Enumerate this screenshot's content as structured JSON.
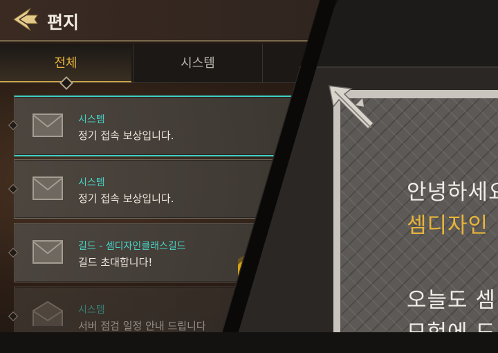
{
  "header": {
    "title": "편지"
  },
  "tabs": [
    {
      "label": "전체",
      "selected": true
    },
    {
      "label": "시스템",
      "selected": false
    }
  ],
  "mails": [
    {
      "sender": "시스템",
      "subject": "정기 접속 보상입니다.",
      "state": "selected",
      "icon": "envelope-closed-icon"
    },
    {
      "sender": "시스템",
      "subject": "정기 접속 보상입니다.",
      "state": "normal",
      "icon": "envelope-closed-icon"
    },
    {
      "sender": "길드 - 셈디자인클래스길드",
      "subject": "길드 초대합니다!",
      "state": "normal",
      "icon": "envelope-closed-icon"
    },
    {
      "sender": "시스템",
      "subject": "서버 점검 일정 안내 드립니다",
      "state": "read",
      "icon": "envelope-open-icon"
    }
  ],
  "letter": {
    "lines": [
      "안녕하세요",
      "셈디자인",
      "오늘도 셈",
      "모험에 도"
    ]
  },
  "colors": {
    "accent_gold": "#e8b53a",
    "accent_teal": "#47d2c4",
    "selected_border": "#3fd0c8"
  }
}
